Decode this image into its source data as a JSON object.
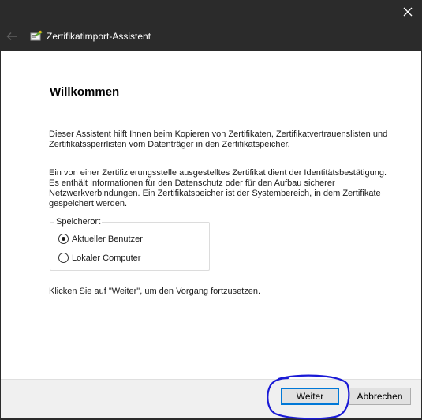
{
  "window": {
    "close_glyph": "✕",
    "close_icon": "close-icon"
  },
  "header": {
    "back_icon": "arrow-left-icon",
    "app_icon": "certificate-icon",
    "title": "Zertifikatimport-Assistent"
  },
  "main": {
    "heading": "Willkommen",
    "para1": "Dieser Assistent hilft Ihnen beim Kopieren von Zertifikaten, Zertifikatvertrauenslisten und\nZertifikatssperrlisten vom Datenträger in den Zertifikatspeicher.",
    "para2": "Ein von einer Zertifizierungsstelle ausgestelltes Zertifikat dient der Identitätsbestätigung.\nEs enthält Informationen für den Datenschutz oder für den Aufbau sicherer\nNetzwerkverbindungen. Ein Zertifikatspeicher ist der Systembereich, in dem Zertifikate\ngespeichert werden.",
    "store_location": {
      "legend": "Speicherort",
      "options": [
        {
          "label": "Aktueller Benutzer",
          "selected": true
        },
        {
          "label": "Lokaler Computer",
          "selected": false
        }
      ]
    },
    "para3": "Klicken Sie auf \"Weiter\", um den Vorgang fortzusetzen."
  },
  "footer": {
    "next_label": "Weiter",
    "cancel_label": "Abbrechen"
  },
  "colors": {
    "titlebar_bg": "#2b2b2b",
    "annotation_stroke": "#1a1ad6",
    "focus_accent": "#0078d7"
  }
}
